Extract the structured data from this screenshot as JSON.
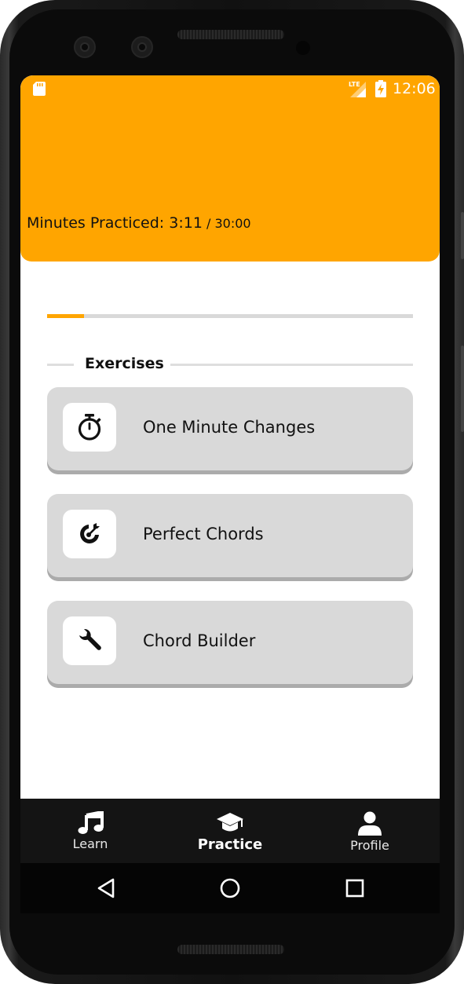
{
  "status_bar": {
    "time": "12:06",
    "network": "LTE"
  },
  "progress": {
    "label": "Minutes Practiced: ",
    "current": "3:11",
    "separator": " / ",
    "total": "30:00",
    "fraction": 0.1
  },
  "section": {
    "title": "Exercises"
  },
  "exercises": [
    {
      "label": "One Minute Changes",
      "icon": "stopwatch-icon"
    },
    {
      "label": "Perfect Chords",
      "icon": "target-icon"
    },
    {
      "label": "Chord Builder",
      "icon": "wrench-icon"
    }
  ],
  "bottom_nav": {
    "items": [
      {
        "label": "Learn",
        "icon": "music-note-icon",
        "active": false
      },
      {
        "label": "Practice",
        "icon": "graduation-cap-icon",
        "active": true
      },
      {
        "label": "Profile",
        "icon": "user-icon",
        "active": false
      }
    ]
  },
  "system_nav": {
    "back": "back-icon",
    "home": "home-icon",
    "recents": "recents-icon"
  },
  "colors": {
    "accent": "#ffa500",
    "card_bg": "#d9d9d9",
    "nav_bg": "#141414"
  }
}
